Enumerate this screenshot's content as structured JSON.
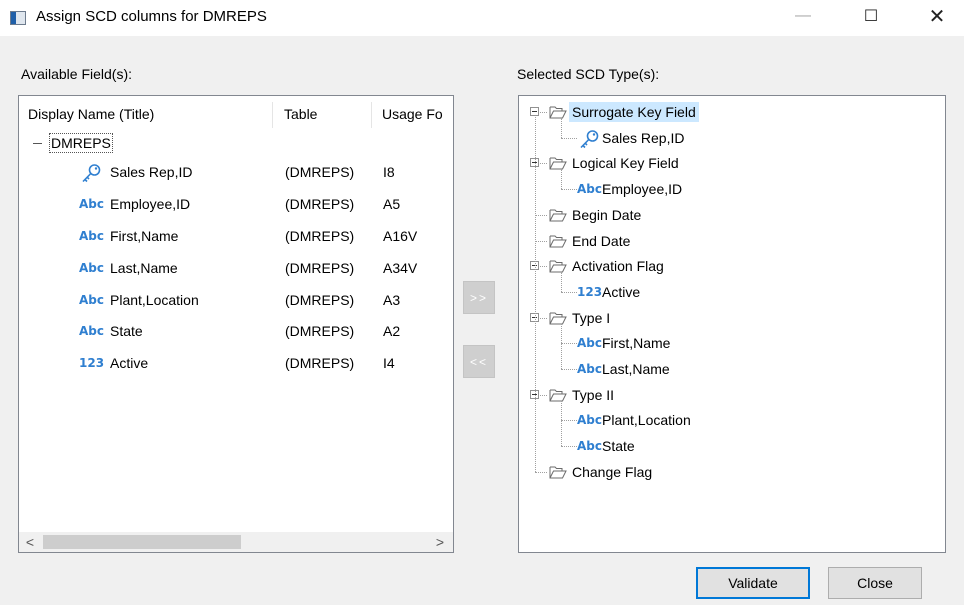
{
  "window": {
    "title": "Assign SCD columns for DMREPS",
    "minimize_glyph": "—",
    "maximize_glyph": "☐",
    "close_glyph": "✕"
  },
  "available": {
    "label": "Available Field(s):",
    "columns": [
      "Display Name (Title)",
      "Table",
      "Usage Fo"
    ],
    "root": "DMREPS",
    "rows": [
      {
        "icon": "key-icon",
        "name": "Sales Rep,ID",
        "table": "(DMREPS)",
        "usage": "I8"
      },
      {
        "icon": "abc-icon",
        "name": "Employee,ID",
        "table": "(DMREPS)",
        "usage": "A5"
      },
      {
        "icon": "abc-icon",
        "name": "First,Name",
        "table": "(DMREPS)",
        "usage": "A16V"
      },
      {
        "icon": "abc-icon",
        "name": "Last,Name",
        "table": "(DMREPS)",
        "usage": "A34V"
      },
      {
        "icon": "abc-icon",
        "name": "Plant,Location",
        "table": "(DMREPS)",
        "usage": "A3"
      },
      {
        "icon": "abc-icon",
        "name": "State",
        "table": "(DMREPS)",
        "usage": "A2"
      },
      {
        "icon": "123-icon",
        "name": "Active",
        "table": "(DMREPS)",
        "usage": "I4"
      }
    ],
    "scroll_left": "<",
    "scroll_right": ">"
  },
  "move": {
    "add_label": ">>",
    "remove_label": "<<"
  },
  "selected": {
    "label": "Selected SCD Type(s):",
    "tree": [
      {
        "label": "Surrogate Key Field",
        "children": [
          {
            "icon": "key-icon",
            "label": "Sales Rep,ID"
          }
        ]
      },
      {
        "label": "Logical Key Field",
        "children": [
          {
            "icon": "abc-icon",
            "label": "Employee,ID"
          }
        ]
      },
      {
        "label": "Begin Date",
        "children": []
      },
      {
        "label": "End Date",
        "children": []
      },
      {
        "label": "Activation Flag",
        "children": [
          {
            "icon": "123-icon",
            "label": "Active"
          }
        ]
      },
      {
        "label": "Type I",
        "children": [
          {
            "icon": "abc-icon",
            "label": "First,Name"
          },
          {
            "icon": "abc-icon",
            "label": "Last,Name"
          }
        ]
      },
      {
        "label": "Type II",
        "children": [
          {
            "icon": "abc-icon",
            "label": "Plant,Location"
          },
          {
            "icon": "abc-icon",
            "label": "State"
          }
        ]
      },
      {
        "label": "Change Flag",
        "children": []
      }
    ]
  },
  "icons": {
    "abc_text": "Abc",
    "num_text": "123"
  },
  "buttons": {
    "validate": "Validate",
    "close": "Close"
  },
  "colors": {
    "selection": "#cce8ff",
    "primary_border": "#0078d7",
    "field_icon": "#2f7fd0"
  }
}
